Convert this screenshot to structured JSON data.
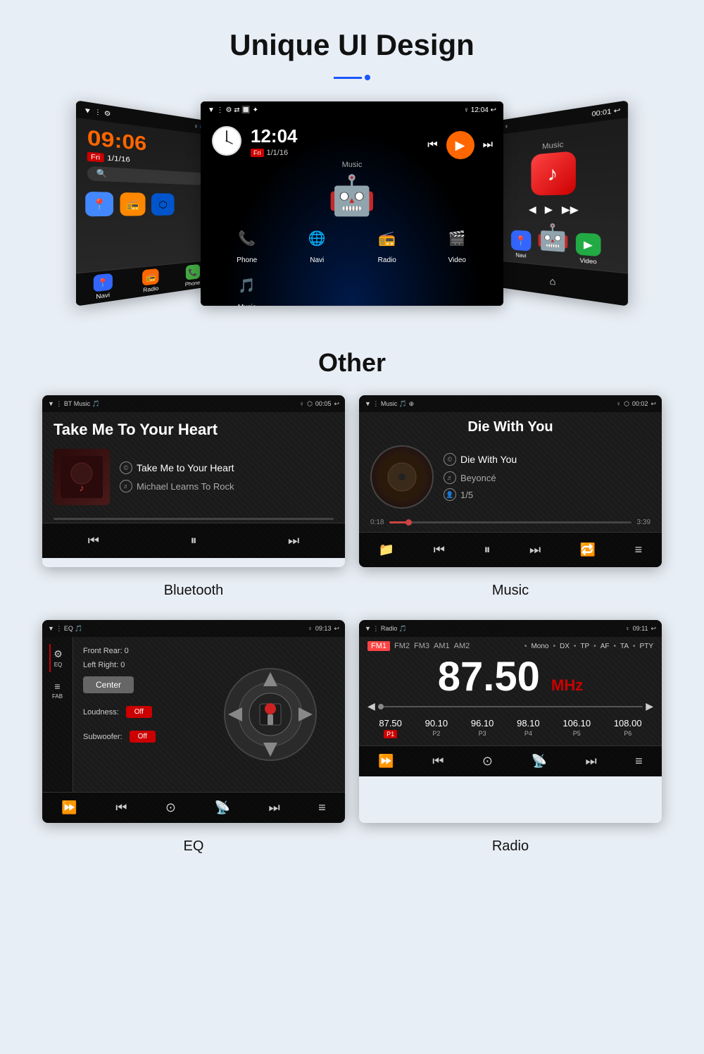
{
  "page": {
    "title": "Unique UI Design",
    "title_divider": "decorator",
    "section2_title": "Other"
  },
  "section1": {
    "left_screen": {
      "time": "09:06",
      "date_badge": "Fri",
      "date": "1/1/16",
      "bottom_apps": [
        "Navi",
        "Radio",
        "Phone"
      ]
    },
    "center_screen": {
      "time": "12:04",
      "date_badge": "Fri",
      "date": "1/1/16",
      "apps": [
        {
          "label": "Phone",
          "icon": "📞"
        },
        {
          "label": "Navi",
          "icon": "🗺"
        },
        {
          "label": "Radio",
          "icon": "📻"
        },
        {
          "label": "Video",
          "icon": "🎬"
        },
        {
          "label": "Music",
          "icon": "🎵"
        }
      ],
      "music_label": "Music"
    },
    "right_screen": {
      "music_label": "Music"
    }
  },
  "bt_player": {
    "statusbar_left": "▼  : BT Music 🎵",
    "statusbar_time": "00:05",
    "title": "Take Me To Your Heart",
    "track": "Take Me to Your Heart",
    "artist": "Michael Learns To Rock",
    "controls": [
      "⏮",
      "⏸",
      "⏭"
    ]
  },
  "music_player": {
    "statusbar_left": "▼  : Music 🎵 ⊕",
    "statusbar_time": "00:02",
    "title": "Die With You",
    "track": "Die With You",
    "artist": "Beyoncé",
    "track_num": "1/5",
    "time_current": "0:18",
    "time_total": "3:39",
    "progress_pct": 8,
    "controls": [
      "📁",
      "⏮",
      "⏸",
      "⏭",
      "🔁",
      "≡"
    ]
  },
  "eq_screen": {
    "statusbar_left": "▼  : EQ 🎵",
    "statusbar_time": "09:13",
    "front_rear": "Front Rear:  0",
    "left_right": "Left Right:  0",
    "center_btn": "Center",
    "loudness_label": "Loudness:",
    "loudness_state": "Off",
    "subwoofer_label": "Subwoofer:",
    "subwoofer_state": "Off",
    "sidebar_items": [
      {
        "label": "EQ",
        "icon": "⚙"
      },
      {
        "label": "FAB",
        "icon": "≡"
      }
    ]
  },
  "radio_screen": {
    "statusbar_left": "▼  : Radio 🎵",
    "statusbar_time": "09:11",
    "tabs": [
      "FM1",
      "FM2",
      "FM3",
      "AM1",
      "AM2"
    ],
    "options": [
      "Mono",
      "DX",
      "TP",
      "AF",
      "TA",
      "PTY"
    ],
    "frequency": "87.50",
    "unit": "MHz",
    "presets": [
      {
        "freq": "87.50",
        "label": "P1",
        "active": true
      },
      {
        "freq": "90.10",
        "label": "P2",
        "active": false
      },
      {
        "freq": "96.10",
        "label": "P3",
        "active": false
      },
      {
        "freq": "98.10",
        "label": "P4",
        "active": false
      },
      {
        "freq": "106.10",
        "label": "P5",
        "active": false
      },
      {
        "freq": "108.00",
        "label": "P6",
        "active": false
      }
    ]
  },
  "captions": {
    "bluetooth": "Bluetooth",
    "music": "Music",
    "eq": "EQ",
    "radio": "Radio"
  }
}
